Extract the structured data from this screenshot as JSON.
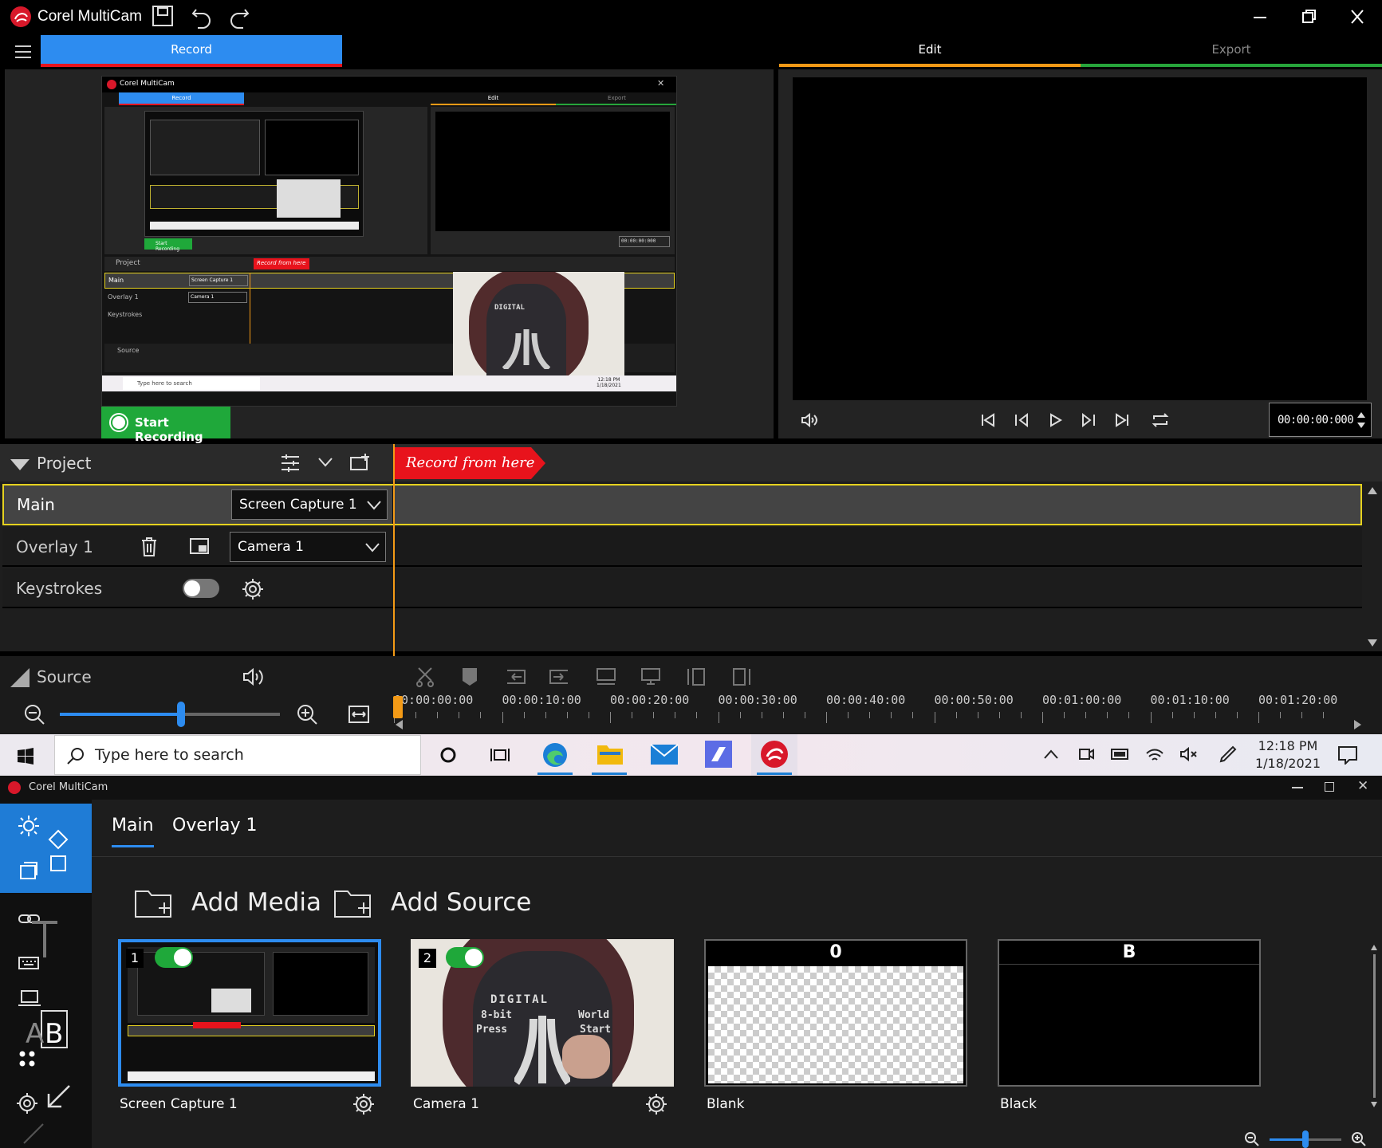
{
  "app": {
    "title": "Corel MultiCam"
  },
  "tabs": {
    "record": "Record",
    "edit": "Edit",
    "export": "Export"
  },
  "preview": {
    "start_recording": "Start Recording",
    "timecode": "00:00:00:000"
  },
  "nested_screenshot": {
    "title": "Corel MultiCam",
    "record_tab": "Record",
    "edit_tab": "Edit",
    "export_tab": "Export",
    "start_recording": "Start Recording",
    "project": "Project",
    "record_from_here": "Record from here",
    "main": "Main",
    "overlay": "Overlay 1",
    "keystrokes": "Keystrokes",
    "source": "Source",
    "screen_capture": "Screen Capture 1",
    "camera": "Camera 1",
    "search": "Type here to search",
    "time": "12:18 PM",
    "date": "1/18/2021",
    "timecode": "00:00:00:000"
  },
  "project": {
    "title": "Project",
    "record_from_here": "Record from here",
    "tracks": [
      {
        "name": "Main",
        "source": "Screen Capture 1"
      },
      {
        "name": "Overlay 1",
        "source": "Camera 1"
      },
      {
        "name": "Keystrokes"
      }
    ]
  },
  "source_bar": {
    "title": "Source",
    "ruler": [
      "00:00:00:00",
      "00:00:10:00",
      "00:00:20:00",
      "00:00:30:00",
      "00:00:40:00",
      "00:00:50:00",
      "00:01:00:00",
      "00:01:10:00",
      "00:01:20:00"
    ],
    "zoom_level": 0.55
  },
  "taskbar": {
    "search_placeholder": "Type here to search",
    "time": "12:18 PM",
    "date": "1/18/2021"
  },
  "source_window": {
    "title": "Corel MultiCam",
    "tabs": [
      "Main",
      "Overlay 1"
    ],
    "add_media": "Add Media",
    "add_source": "Add Source",
    "cards": [
      {
        "number": "1",
        "label": "Screen Capture 1",
        "enabled": true
      },
      {
        "number": "2",
        "label": "Camera 1",
        "enabled": true
      },
      {
        "header": "0",
        "label": "Blank"
      },
      {
        "header": "B",
        "label": "Black"
      }
    ],
    "zoom_level": 0.5
  },
  "camera_shirt": {
    "line1": "DIGITAL",
    "line2a": "8-bit",
    "line2b": "World",
    "line3a": "Press",
    "line3b": "Start"
  },
  "colors": {
    "accent_blue": "#2d8cf0",
    "record_red": "#e8131c",
    "recording_green": "#1fa83a",
    "highlight_yellow": "#e6d21f",
    "playhead_orange": "#f39a16"
  }
}
